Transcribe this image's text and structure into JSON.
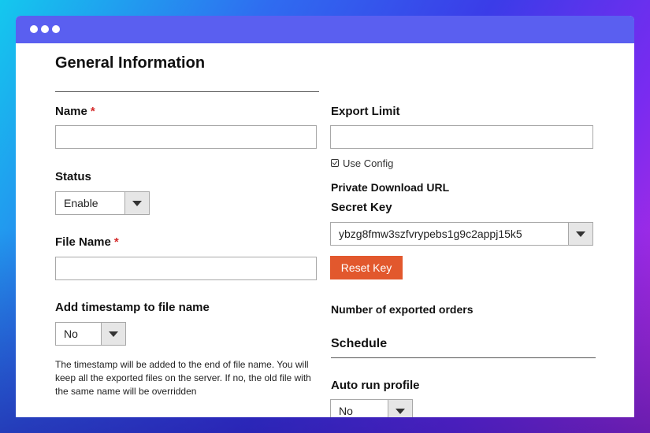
{
  "colors": {
    "accent": "#e2582d",
    "titlebar": "#5a5ff0",
    "required": "#d42a2a"
  },
  "left": {
    "section_title": "General Information",
    "name": {
      "label": "Name",
      "required_mark": "*",
      "value": ""
    },
    "status": {
      "label": "Status",
      "selected": "Enable"
    },
    "file_name": {
      "label": "File Name",
      "required_mark": "*",
      "value": ""
    },
    "timestamp": {
      "label": "Add timestamp to file name",
      "selected": "No",
      "help": "The timestamp will be added to the end of file name. You will keep all the exported files on the server. If no, the old file with the same name will be overridden"
    }
  },
  "right": {
    "export_limit": {
      "label": "Export Limit",
      "value": ""
    },
    "use_config": {
      "label": "Use Config",
      "checked": true
    },
    "private_url_label": "Private Download URL",
    "secret_key": {
      "label": "Secret Key",
      "selected": "ybzg8fmw3szfvrypebs1g9c2appj15k5"
    },
    "reset_key_label": "Reset Key",
    "exported_orders_label": "Number of exported orders",
    "schedule_title": "Schedule",
    "auto_run": {
      "label": "Auto run profile",
      "selected": "No"
    }
  }
}
